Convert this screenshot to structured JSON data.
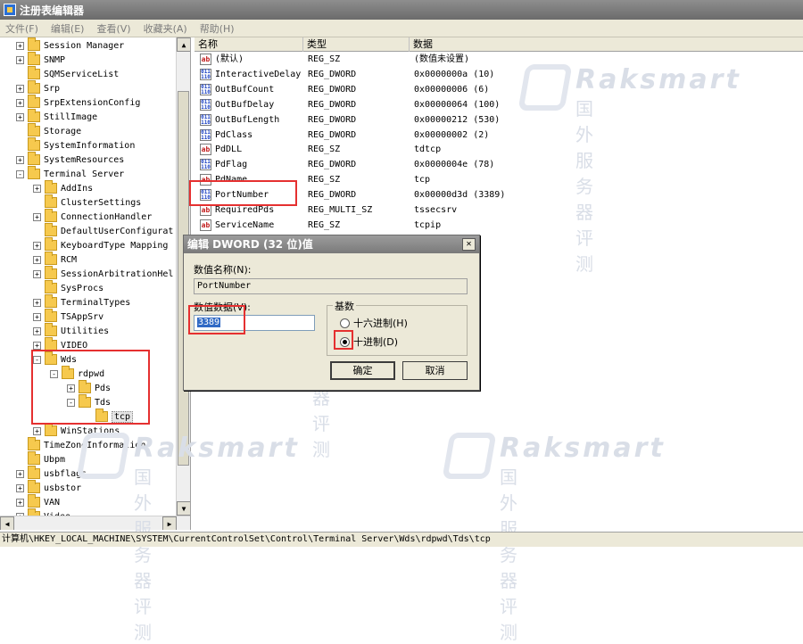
{
  "window": {
    "title": "注册表编辑器"
  },
  "menu": [
    "文件(F)",
    "编辑(E)",
    "查看(V)",
    "收藏夹(A)",
    "帮助(H)"
  ],
  "tree": [
    {
      "label": "Session Manager",
      "exp": "+",
      "indent": 0
    },
    {
      "label": "SNMP",
      "exp": "+",
      "indent": 0
    },
    {
      "label": "SQMServiceList",
      "exp": "",
      "indent": 0
    },
    {
      "label": "Srp",
      "exp": "+",
      "indent": 0
    },
    {
      "label": "SrpExtensionConfig",
      "exp": "+",
      "indent": 0
    },
    {
      "label": "StillImage",
      "exp": "+",
      "indent": 0
    },
    {
      "label": "Storage",
      "exp": "",
      "indent": 0
    },
    {
      "label": "SystemInformation",
      "exp": "",
      "indent": 0
    },
    {
      "label": "SystemResources",
      "exp": "+",
      "indent": 0
    },
    {
      "label": "Terminal Server",
      "exp": "-",
      "indent": 0
    },
    {
      "label": "AddIns",
      "exp": "+",
      "indent": 1
    },
    {
      "label": "ClusterSettings",
      "exp": "",
      "indent": 1
    },
    {
      "label": "ConnectionHandler",
      "exp": "+",
      "indent": 1
    },
    {
      "label": "DefaultUserConfigurat",
      "exp": "",
      "indent": 1
    },
    {
      "label": "KeyboardType Mapping",
      "exp": "+",
      "indent": 1
    },
    {
      "label": "RCM",
      "exp": "+",
      "indent": 1
    },
    {
      "label": "SessionArbitrationHel",
      "exp": "+",
      "indent": 1
    },
    {
      "label": "SysProcs",
      "exp": "",
      "indent": 1
    },
    {
      "label": "TerminalTypes",
      "exp": "+",
      "indent": 1
    },
    {
      "label": "TSAppSrv",
      "exp": "+",
      "indent": 1
    },
    {
      "label": "Utilities",
      "exp": "+",
      "indent": 1
    },
    {
      "label": "VIDEO",
      "exp": "+",
      "indent": 1
    },
    {
      "label": "Wds",
      "exp": "-",
      "indent": 1
    },
    {
      "label": "rdpwd",
      "exp": "-",
      "indent": 2
    },
    {
      "label": "Pds",
      "exp": "+",
      "indent": 3
    },
    {
      "label": "Tds",
      "exp": "-",
      "indent": 3
    },
    {
      "label": "tcp",
      "exp": "",
      "indent": 4,
      "selected": true
    },
    {
      "label": "WinStations",
      "exp": "+",
      "indent": 1
    },
    {
      "label": "TimeZoneInformation",
      "exp": "",
      "indent": 0
    },
    {
      "label": "Ubpm",
      "exp": "",
      "indent": 0
    },
    {
      "label": "usbflags",
      "exp": "+",
      "indent": 0
    },
    {
      "label": "usbstor",
      "exp": "+",
      "indent": 0
    },
    {
      "label": "VAN",
      "exp": "+",
      "indent": 0
    },
    {
      "label": "Video",
      "exp": "+",
      "indent": 0
    }
  ],
  "columns": {
    "name": "名称",
    "type": "类型",
    "data": "数据"
  },
  "values": [
    {
      "icon": "sz",
      "name": "(默认)",
      "type": "REG_SZ",
      "data": "(数值未设置)"
    },
    {
      "icon": "bin",
      "name": "InteractiveDelay",
      "type": "REG_DWORD",
      "data": "0x0000000a (10)"
    },
    {
      "icon": "bin",
      "name": "OutBufCount",
      "type": "REG_DWORD",
      "data": "0x00000006 (6)"
    },
    {
      "icon": "bin",
      "name": "OutBufDelay",
      "type": "REG_DWORD",
      "data": "0x00000064 (100)"
    },
    {
      "icon": "bin",
      "name": "OutBufLength",
      "type": "REG_DWORD",
      "data": "0x00000212 (530)"
    },
    {
      "icon": "bin",
      "name": "PdClass",
      "type": "REG_DWORD",
      "data": "0x00000002 (2)"
    },
    {
      "icon": "sz",
      "name": "PdDLL",
      "type": "REG_SZ",
      "data": "tdtcp"
    },
    {
      "icon": "bin",
      "name": "PdFlag",
      "type": "REG_DWORD",
      "data": "0x0000004e (78)"
    },
    {
      "icon": "sz",
      "name": "PdName",
      "type": "REG_SZ",
      "data": "tcp"
    },
    {
      "icon": "bin",
      "name": "PortNumber",
      "type": "REG_DWORD",
      "data": "0x00000d3d (3389)"
    },
    {
      "icon": "sz",
      "name": "RequiredPds",
      "type": "REG_MULTI_SZ",
      "data": "tssecsrv"
    },
    {
      "icon": "sz",
      "name": "ServiceName",
      "type": "REG_SZ",
      "data": "tcpip"
    }
  ],
  "dialog": {
    "title": "编辑 DWORD (32 位)值",
    "close": "✕",
    "name_label": "数值名称(N):",
    "name_value": "PortNumber",
    "data_label": "数值数据(V):",
    "data_value": "3389",
    "base_label": "基数",
    "hex_label": "十六进制(H)",
    "dec_label": "十进制(D)",
    "ok": "确定",
    "cancel": "取消"
  },
  "watermark": {
    "brand": "Raksmart",
    "tagline": "国外服务器评测"
  },
  "status_path": "计算机\\HKEY_LOCAL_MACHINE\\SYSTEM\\CurrentControlSet\\Control\\Terminal Server\\Wds\\rdpwd\\Tds\\tcp"
}
